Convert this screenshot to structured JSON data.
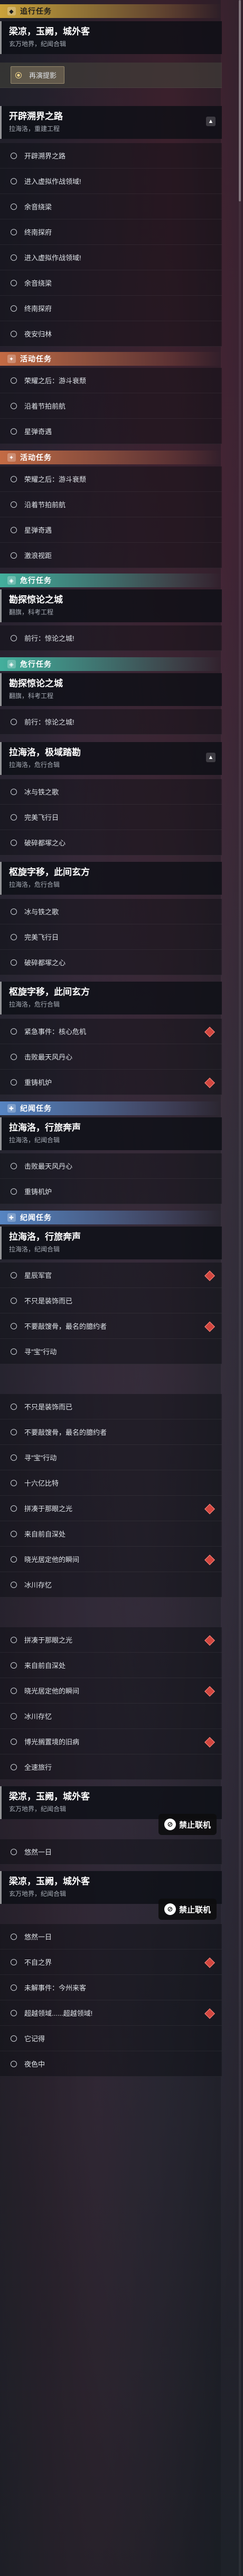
{
  "categories": {
    "main": "追行任务",
    "activity": "活动任务",
    "legend": "纪闻任务",
    "event": "危行任务"
  },
  "quests": {
    "q1": {
      "title": "梁凉，玉阙，城外客",
      "subtitle": "玄万地界，纪闻合辑"
    },
    "q2": {
      "title": "开辟溯界之路",
      "subtitle": "拉海洛，重建工程"
    },
    "q3": {
      "title": "勘探惊论之城",
      "subtitle": "翻旗，科考工程"
    },
    "q4": {
      "title": "勘探惊论之城",
      "subtitle": "翻旗，科考工程"
    },
    "q5": {
      "title": "拉海洛，极域踏勘",
      "subtitle": "拉海洛，危行合辑"
    },
    "q6": {
      "title": "枢旋字移，此间玄方",
      "subtitle": "拉海洛，危行合辑"
    },
    "q7": {
      "title": "枢旋字移，此间玄方",
      "subtitle": "拉海洛，危行合辑"
    },
    "q8": {
      "title": "拉海洛，行旅奔声",
      "subtitle": "拉海洛，纪闻合辑"
    },
    "q9": {
      "title": "拉海洛，行旅奔声",
      "subtitle": "拉海洛，纪闻合辑"
    },
    "q10": {
      "title": "梁凉，玉阙，城外客",
      "subtitle": "玄万地界，纪闻合辑"
    },
    "q11": {
      "title": "梁凉，玉阙，城外客",
      "subtitle": "玄万地界，纪闻合辑"
    }
  },
  "steps": {
    "s_active": "再演提影",
    "s1": "开辟溯界之路",
    "s2": "进入虚拟作战领域!",
    "s3": "余音绕梁",
    "s4": "终南探府",
    "s5": "进入虚拟作战领域!",
    "s6": "余音绕梁",
    "s7": "终南探府",
    "s8": "夜安归林",
    "a1": "荣耀之后：游斗衰颓",
    "a2": "沿着节拍前航",
    "a3": "星弹奇遇",
    "a4": "荣耀之后：游斗衰颓",
    "a5": "沿着节拍前航",
    "a6": "星弹奇遇",
    "a7": "激浪视距",
    "e1": "前行：惊论之城!",
    "e2": "前行：惊论之城!",
    "b1": "冰与铁之歌",
    "b2": "完美飞行日",
    "b3": "破碎都塚之心",
    "b4": "冰与铁之歌",
    "b5": "完美飞行日",
    "b6": "破碎都塚之心",
    "c1": "紧急事件：核心危机",
    "c2": "击败最天风丹心",
    "c3": "重铸机炉",
    "c4": "击败最天风丹心",
    "c5": "重铸机炉",
    "d1": "星辰军官",
    "d2": "不只是装饰而已",
    "d3": "不要敲馊骨，最名的臆约者",
    "d4": "寻\"宝\"行动",
    "d5": "不只是装饰而已",
    "d6": "不要敲馊骨，最名的臆约者",
    "d7": "寻\"宝\"行动",
    "d8": "十六亿比特",
    "d9": "拼凑于那眼之光",
    "d10": "来自前自深处",
    "d11": "晓光居定他的瞬间",
    "d12": "冰川存忆",
    "d13": "拼凑于那眼之光",
    "d14": "来自前自深处",
    "d15": "晓光居定他的瞬间",
    "d16": "冰川存忆",
    "d17": "博光搁置境的旧病",
    "d18": "全速旅行",
    "f1": "悠然一日",
    "f2": "悠然一日",
    "f3": "不自之界",
    "f4": "未解事件：今州来客",
    "f5": "超越领域......超越领域!",
    "f6": "它记得",
    "f7": "夜色中"
  },
  "badge": {
    "label": "禁止联机",
    "icon": "no-online-icon"
  },
  "colors": {
    "main": "#e8b93e",
    "activity": "#df7848",
    "legend": "#6096dc",
    "event": "#48c8b0",
    "danger": "#d2463f"
  }
}
